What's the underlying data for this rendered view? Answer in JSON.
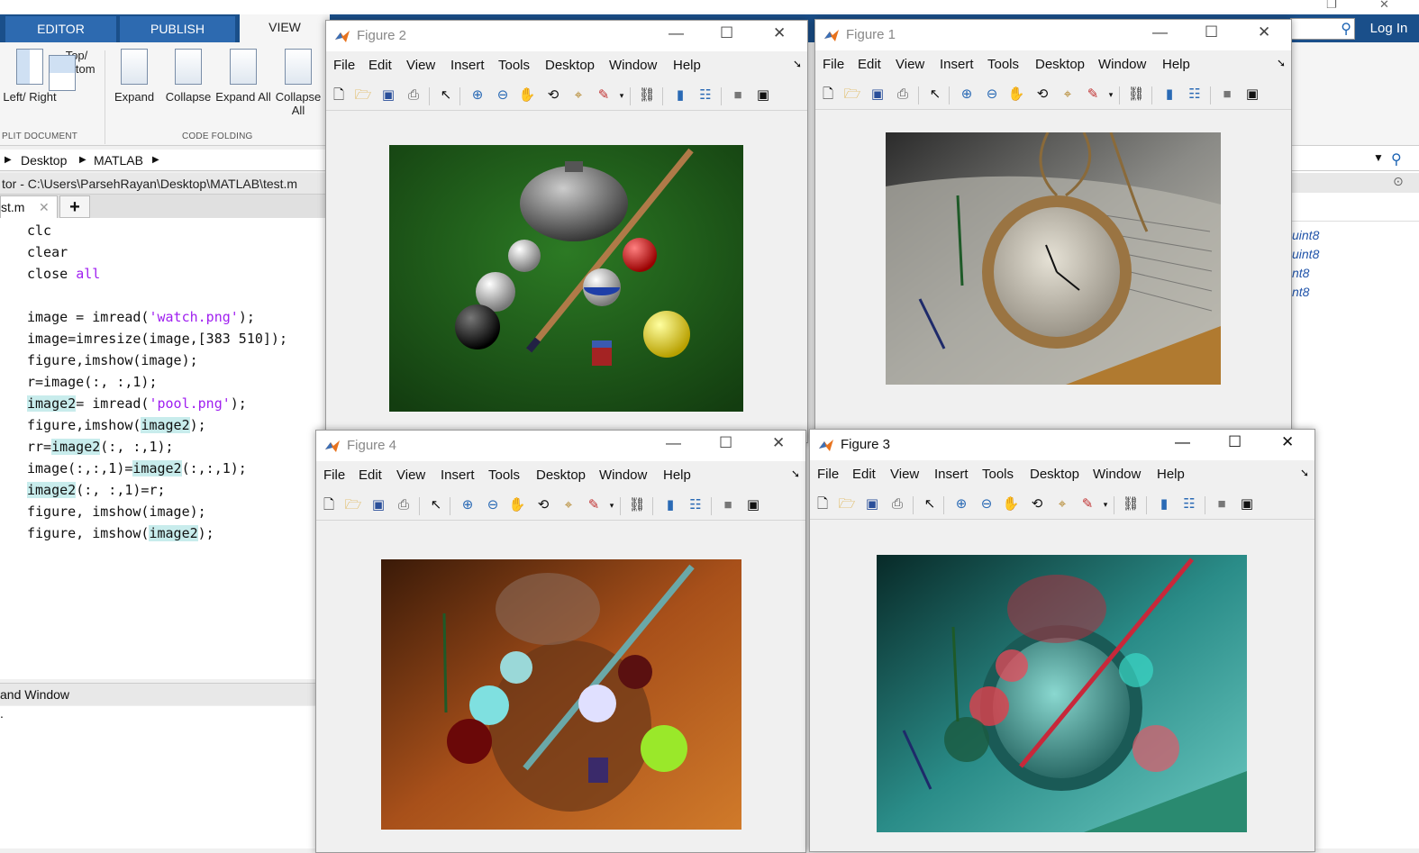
{
  "ribbon": {
    "tabs": [
      "EDITOR",
      "PUBLISH",
      "VIEW"
    ],
    "login": "Log In",
    "buttons": {
      "left_right": "Left/ Right",
      "top_bottom": "Top/ Bottom",
      "expand": "Expand",
      "collapse": "Collapse",
      "expand_all": "Expand All",
      "collapse_all": "Collapse All"
    },
    "groups": {
      "split": "PLIT DOCUMENT",
      "folding": "CODE FOLDING"
    }
  },
  "address": {
    "crumbs": [
      "Desktop",
      "MATLAB"
    ]
  },
  "editor": {
    "title": "tor - C:\\Users\\ParsehRayan\\Desktop\\MATLAB\\test.m",
    "tab": "st.m",
    "tab_close": "✕",
    "new_tab": "+"
  },
  "code": [
    [
      "clc"
    ],
    [
      "clear"
    ],
    [
      "close ",
      "all"
    ],
    [
      ""
    ],
    [
      "image = imread(",
      "'watch.png'",
      ");"
    ],
    [
      "image=imresize(image,[383 510]);"
    ],
    [
      "figure,imshow(image);"
    ],
    [
      "r=image(:, :,1);"
    ],
    [
      "image2",
      "= imread(",
      "'pool.png'",
      ");"
    ],
    [
      "figure,imshow(",
      "image2",
      ");"
    ],
    [
      "rr=",
      "image2",
      "(:, :,1);"
    ],
    [
      "image(:,:,1)=",
      "image2",
      "(:,:,1);"
    ],
    [
      "image2",
      "(:, :,1)=r;"
    ],
    [
      "figure, imshow(image);"
    ],
    [
      "figure, imshow(",
      "image2",
      ");"
    ]
  ],
  "command_window": {
    "title": "and Window",
    "prompt": "."
  },
  "workspace": {
    "types": [
      "uint8",
      "uint8",
      "nt8",
      "nt8"
    ]
  },
  "figure_menu": [
    "File",
    "Edit",
    "View",
    "Insert",
    "Tools",
    "Desktop",
    "Window",
    "Help"
  ],
  "figures": {
    "fig2": {
      "title": "Figure 2",
      "image": "pool table: teapot, billiard balls and cue on green felt"
    },
    "fig1": {
      "title": "Figure 1",
      "image": "pocket watch lying on open book with ruler"
    },
    "fig4": {
      "title": "Figure 4",
      "image": "red-channel swapped composite, orange tint"
    },
    "fig3": {
      "title": "Figure 3",
      "image": "red-channel swapped composite, teal tint"
    }
  },
  "toolbar_icons": [
    "new-icon",
    "open-icon",
    "save-icon",
    "print-icon",
    "pointer-icon",
    "zoom-in-icon",
    "zoom-out-icon",
    "pan-icon",
    "rotate-icon",
    "data-cursor-icon",
    "brush-icon",
    "link-icon",
    "colorbar-icon",
    "legend-icon",
    "hide-icon",
    "dock-icon"
  ],
  "colors": {
    "ribbon_blue": "#1a4f8a",
    "felt_green": "#1f5a1a",
    "teal": "#2a8c88",
    "orange": "#b35a1a"
  }
}
